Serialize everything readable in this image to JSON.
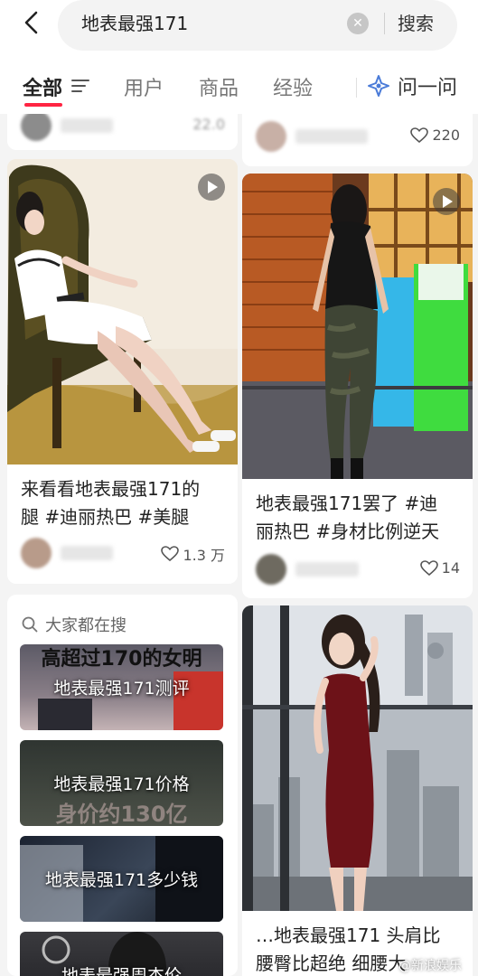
{
  "header": {
    "search_query": "地表最强171",
    "search_button": "搜索"
  },
  "tabs": [
    {
      "label": "全部"
    },
    {
      "label": "用户"
    },
    {
      "label": "商品"
    },
    {
      "label": "经验"
    }
  ],
  "ask_label": "问一问",
  "top_partial": {
    "left_likes": "22.0",
    "right_likes": "220"
  },
  "posts": [
    {
      "title_line1": "来看看地表最强171的",
      "title_line2": "腿 #迪丽热巴 #美腿",
      "likes": "1.3 万"
    },
    {
      "title_line1": "地表最强171罢了 #迪",
      "title_line2": "丽热巴 #身材比例逆天",
      "likes": "14"
    },
    {
      "title_line1": "…地表最强171  头肩比",
      "title_line2": "腰臀比超绝 细腰大"
    }
  ],
  "trending": {
    "title": "大家都在搜",
    "items": [
      {
        "label": "地表最强171测评",
        "overlay": "高超过170的女明"
      },
      {
        "label": "地表最强171价格",
        "overlay": "身价约130亿"
      },
      {
        "label": "地表最强171多少钱",
        "overlay": ""
      },
      {
        "label": "地表最强周杰伦",
        "overlay": ""
      }
    ]
  },
  "watermark": "@新浪娱乐"
}
